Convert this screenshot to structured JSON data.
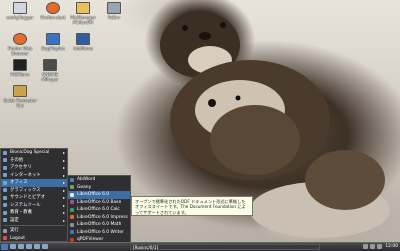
{
  "desktop_icons": [
    {
      "label": "conky/logger",
      "icon": "terminal-icon"
    },
    {
      "label": "Firefox-start",
      "icon": "firefox-icon"
    },
    {
      "label": "FileManager\nPCManFM",
      "icon": "file-manager-icon"
    },
    {
      "label": "PcDrv",
      "icon": "drive-icon"
    },
    {
      "label": "Firefox Web\nBrowser",
      "icon": "firefox-icon"
    },
    {
      "label": "DogPlaylist",
      "icon": "playlist-icon"
    },
    {
      "label": "AddMenu",
      "icon": "add-icon"
    },
    {
      "label": "ROXTerm",
      "icon": "terminal-icon"
    },
    {
      "label": "GNOME\nMPlayer",
      "icon": "player-icon"
    },
    {
      "label": "Quick Remaster\nGui",
      "icon": "remaster-icon"
    }
  ],
  "start_menu": {
    "items": [
      {
        "label": "BionicDog Special",
        "has_sub": true
      },
      {
        "label": "その他",
        "has_sub": true
      },
      {
        "label": "アクセサリ",
        "has_sub": true
      },
      {
        "label": "インターネット",
        "has_sub": true
      },
      {
        "label": "オフィス",
        "has_sub": true,
        "active": true
      },
      {
        "label": "グラフィックス",
        "has_sub": true
      },
      {
        "label": "サウンドとビデオ",
        "has_sub": true
      },
      {
        "label": "システムツール",
        "has_sub": true
      },
      {
        "label": "教育・教養",
        "has_sub": true
      },
      {
        "label": "設定",
        "has_sub": true
      },
      {
        "label": "実行",
        "has_sub": false
      },
      {
        "label": "Logout",
        "has_sub": false
      }
    ]
  },
  "office_submenu": {
    "items": [
      {
        "label": "AbiWord",
        "color": "#4f7fc0"
      },
      {
        "label": "Geany",
        "color": "#6aa84f"
      },
      {
        "label": "LibreOffice 6.0",
        "color": "#e8e8e8",
        "active": true
      },
      {
        "label": "LibreOffice 6.0 Base",
        "color": "#a64d79"
      },
      {
        "label": "LibreOffice 6.0 Calc",
        "color": "#38a05a"
      },
      {
        "label": "LibreOffice 6.0 Impress",
        "color": "#d86a2b"
      },
      {
        "label": "LibreOffice 6.0 Math",
        "color": "#8e8e8e"
      },
      {
        "label": "LibreOffice 6.0 Writer",
        "color": "#3d78c4"
      },
      {
        "label": "qPDFViewer",
        "color": "#c0392b"
      }
    ]
  },
  "tooltip": {
    "text": "オープンで標準化されたODF ドキュメント形式に準拠したオフィススイートです。The Document Foundation によってサポートされています。"
  },
  "taskbar": {
    "window_title": "[Roxinc/0/1]",
    "clock": "12:00"
  }
}
